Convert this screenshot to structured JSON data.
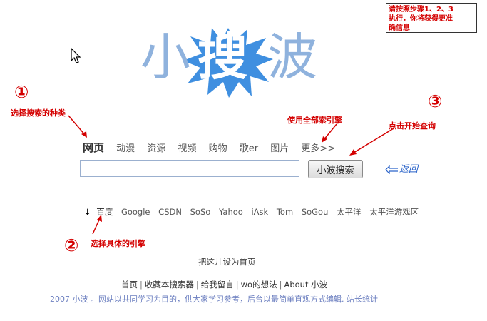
{
  "note": {
    "lines": [
      "请按照步骤1、2、3",
      "执行，你将获得更准",
      "确信息"
    ]
  },
  "logo": {
    "chars": [
      "小",
      "搜",
      "波"
    ]
  },
  "tabs": [
    "网页",
    "动漫",
    "资源",
    "视频",
    "购物",
    "歌er",
    "图片",
    "更多>>"
  ],
  "search": {
    "value": "",
    "placeholder": "",
    "button": "小波搜索",
    "back_label": "返回"
  },
  "engines": {
    "arrow": "↓",
    "items": [
      "百度",
      "Google",
      "CSDN",
      "SoSo",
      "Yahoo",
      "iAsk",
      "Tom",
      "SoGou",
      "太平洋",
      "太平洋游戏区"
    ]
  },
  "annotations": {
    "step1_num": "①",
    "step1": "选择搜索的种类",
    "step2_num": "②",
    "step2": "选择具体的引擎",
    "step3_num": "③",
    "step3": "点击开始查询",
    "all_engines": "使用全部索引擎"
  },
  "homepage_link": "把这儿设为首页",
  "footer": {
    "links": [
      "首页",
      "收藏本搜索器",
      "给我留言",
      "wo的想法",
      "About 小波"
    ],
    "separator": "|",
    "copyright": "2007 小波 。网站以共同学习为目的，供大家学习参考，后台以最简单直观方式编辑. 站长统计"
  },
  "colors": {
    "annotation": "#d40000",
    "logo_text": "#8fb2dd",
    "splash": "#3f8fe0",
    "footer_copy": "#6c7fc0"
  }
}
